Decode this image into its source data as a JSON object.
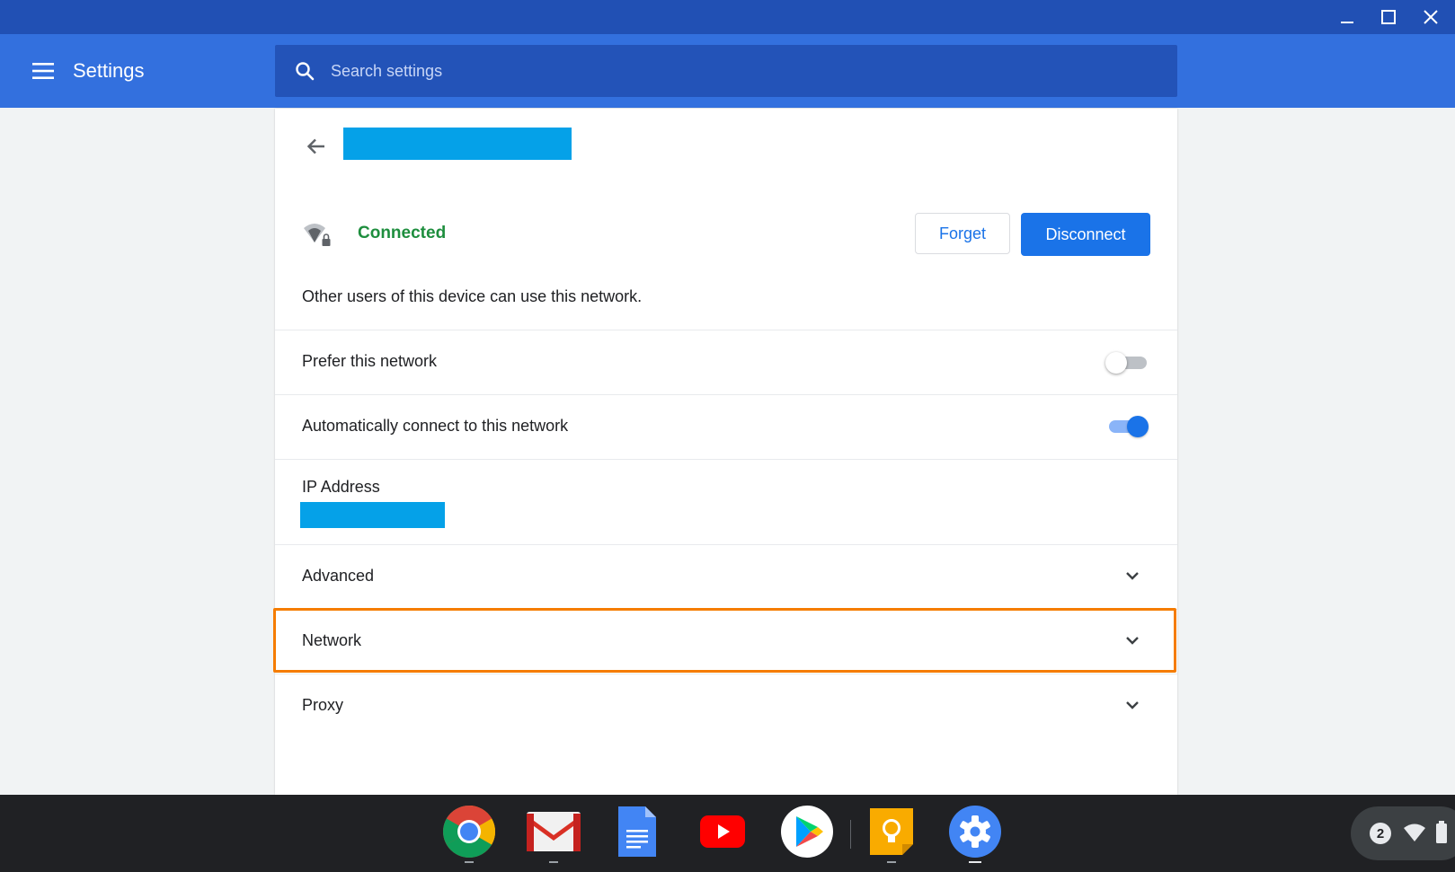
{
  "window": {
    "controls": [
      "minimize-icon",
      "maximize-icon",
      "close-icon"
    ]
  },
  "header": {
    "menu_icon": "hamburger-menu-icon",
    "title": "Settings",
    "search_placeholder": "Search settings",
    "search_value": ""
  },
  "network_detail": {
    "back_icon": "arrow-back-icon",
    "status": "Connected",
    "status_color": "#1e8e3e",
    "forget_label": "Forget",
    "disconnect_label": "Disconnect",
    "shared_note": "Other users of this device can use this network.",
    "prefer": {
      "label": "Prefer this network",
      "enabled": false
    },
    "auto_connect": {
      "label": "Automatically connect to this network",
      "enabled": true
    },
    "ip_label": "IP Address",
    "sections": [
      {
        "label": "Advanced",
        "expanded": false
      },
      {
        "label": "Network",
        "expanded": false
      },
      {
        "label": "Proxy",
        "expanded": false
      }
    ]
  },
  "colors": {
    "titlebar": "#2150b4",
    "appbar": "#3370de",
    "accent": "#1a73e8",
    "redaction": "#05a1e8",
    "highlight": "#f57c00"
  },
  "shelf": {
    "apps": [
      {
        "name": "chrome-icon"
      },
      {
        "name": "gmail-icon"
      },
      {
        "name": "docs-icon"
      },
      {
        "name": "youtube-icon"
      },
      {
        "name": "play-store-icon"
      },
      {
        "name": "keep-icon"
      },
      {
        "name": "settings-icon",
        "active": true
      }
    ],
    "tray": {
      "notification_count": "2"
    }
  }
}
